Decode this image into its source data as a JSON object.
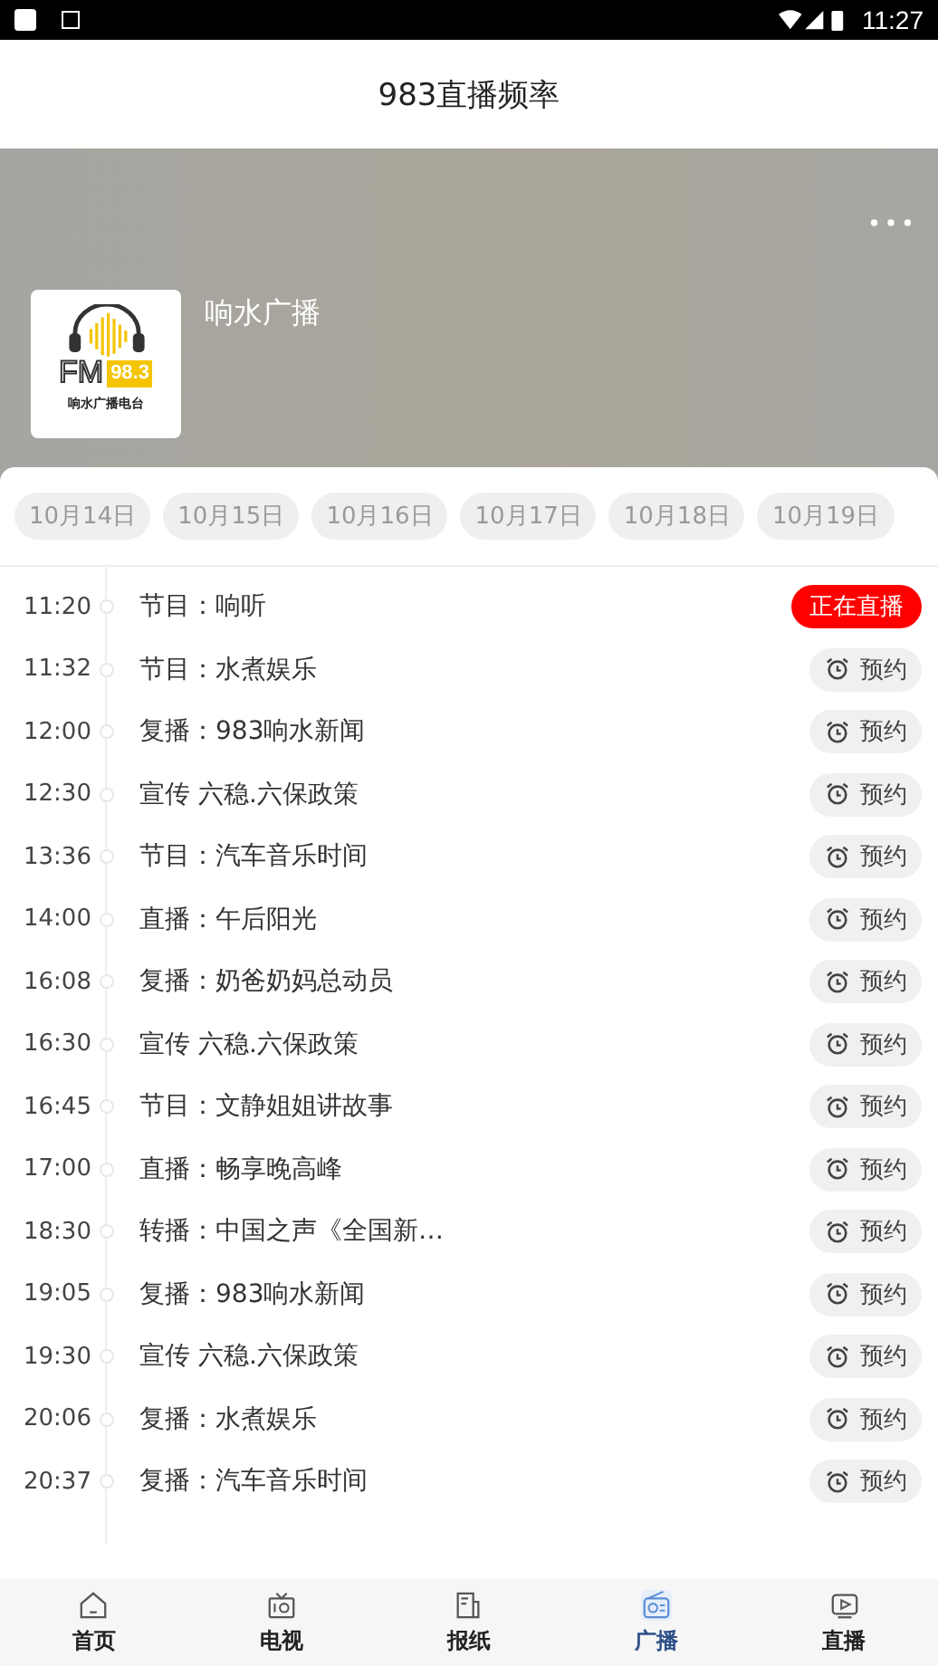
{
  "status_bar": {
    "time": "11:27"
  },
  "header": {
    "title": "983直播频率"
  },
  "station": {
    "name": "响水广播",
    "logo": {
      "brand": "FM",
      "frequency": "98.3",
      "caption": "响水广播电台"
    }
  },
  "dates": [
    "10月14日",
    "10月15日",
    "10月16日",
    "10月17日",
    "10月18日",
    "10月19日"
  ],
  "schedule": [
    {
      "time": "11:20",
      "title": "节目：响听",
      "kind": "live",
      "action": "正在直播"
    },
    {
      "time": "11:32",
      "title": "节目：水煮娱乐",
      "kind": "reserve",
      "action": "预约"
    },
    {
      "time": "12:00",
      "title": "复播：983响水新闻",
      "kind": "reserve",
      "action": "预约"
    },
    {
      "time": "12:30",
      "title": "宣传 六稳.六保政策",
      "kind": "reserve",
      "action": "预约"
    },
    {
      "time": "13:36",
      "title": "节目：汽车音乐时间",
      "kind": "reserve",
      "action": "预约"
    },
    {
      "time": "14:00",
      "title": "直播：午后阳光",
      "kind": "reserve",
      "action": "预约"
    },
    {
      "time": "16:08",
      "title": "复播：奶爸奶妈总动员",
      "kind": "reserve",
      "action": "预约"
    },
    {
      "time": "16:30",
      "title": "宣传 六稳.六保政策",
      "kind": "reserve",
      "action": "预约"
    },
    {
      "time": "16:45",
      "title": "节目：文静姐姐讲故事",
      "kind": "reserve",
      "action": "预约"
    },
    {
      "time": "17:00",
      "title": "直播：畅享晚高峰",
      "kind": "reserve",
      "action": "预约"
    },
    {
      "time": "18:30",
      "title": "转播：中国之声《全国新…",
      "kind": "reserve",
      "action": "预约"
    },
    {
      "time": "19:05",
      "title": "复播：983响水新闻",
      "kind": "reserve",
      "action": "预约"
    },
    {
      "time": "19:30",
      "title": "宣传 六稳.六保政策",
      "kind": "reserve",
      "action": "预约"
    },
    {
      "time": "20:06",
      "title": "复播：水煮娱乐",
      "kind": "reserve",
      "action": "预约"
    },
    {
      "time": "20:37",
      "title": "复播：汽车音乐时间",
      "kind": "reserve",
      "action": "预约"
    }
  ],
  "bottom_nav": [
    {
      "label": "首页",
      "selected": false
    },
    {
      "label": "电视",
      "selected": false
    },
    {
      "label": "报纸",
      "selected": false
    },
    {
      "label": "广播",
      "selected": true
    },
    {
      "label": "直播",
      "selected": false
    }
  ]
}
